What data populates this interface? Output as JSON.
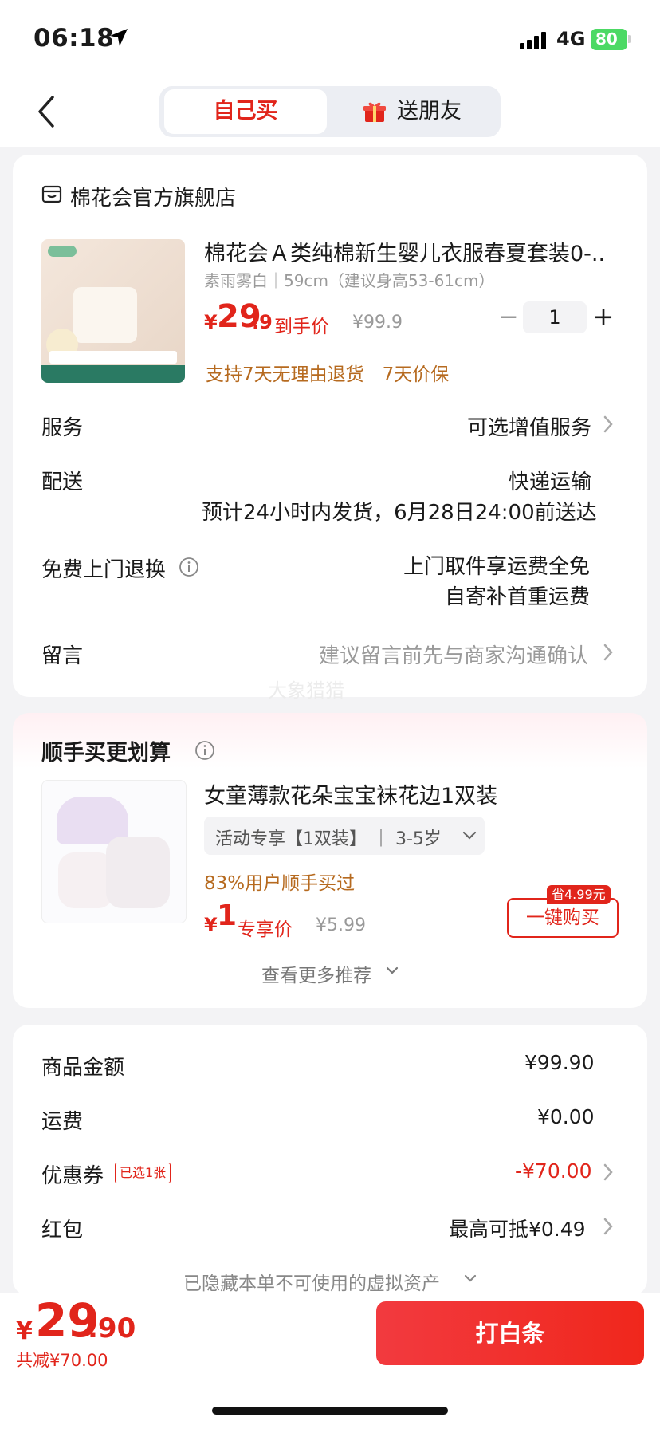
{
  "status": {
    "time": "06:18",
    "network": "4G",
    "battery": "80"
  },
  "header": {
    "tab_self": "自己买",
    "tab_friend": "送朋友"
  },
  "store": {
    "name": "棉花会官方旗舰店"
  },
  "product": {
    "title": "棉花会Ａ类纯棉新生婴儿衣服春夏套装0-...",
    "spec": "素雨雾白｜59cm（建议身高53-61cm）",
    "price_symbol": "¥",
    "price_int": "29",
    "price_dec": ".9",
    "price_tag": "到手价",
    "price_original": "¥99.9",
    "quantity": "1",
    "guarantee": "支持7天无理由退货　7天价保"
  },
  "rows": {
    "service_label": "服务",
    "service_value": "可选增值服务",
    "delivery_label": "配送",
    "delivery_value1": "快递运输",
    "delivery_value2": "预计24小时内发货，6月28日24:00前送达",
    "return_label": "免费上门退换",
    "return_value1": "上门取件享运费全免",
    "return_value2": "自寄补首重运费",
    "message_label": "留言",
    "message_value": "建议留言前先与商家沟通确认"
  },
  "watermark": "大象猎猎",
  "upsell": {
    "title": "顺手买更划算",
    "name": "女童薄款花朵宝宝袜花边1双装",
    "spec": "活动专享【1双装】 ｜ 3-5岁",
    "stat": "83%用户顺手买过",
    "price_symbol": "¥",
    "price": "1",
    "price_tag": "专享价",
    "price_original": "¥5.99",
    "save_badge": "省4.99元",
    "buy_button": "一键购买",
    "more": "查看更多推荐"
  },
  "summary": {
    "amount_label": "商品金额",
    "amount_value": "¥99.90",
    "shipping_label": "运费",
    "shipping_value": "¥0.00",
    "coupon_label": "优惠券",
    "coupon_tag": "已选1张",
    "coupon_value": "-¥70.00",
    "redpacket_label": "红包",
    "redpacket_value": "最高可抵¥0.49",
    "hidden_assets": "已隐藏本单不可使用的虚拟资产"
  },
  "footer": {
    "total_symbol": "¥",
    "total_int": "29",
    "total_dec": ".90",
    "total_saved": "共减¥70.00",
    "pay_button": "打白条"
  },
  "colors": {
    "accent": "#e1251b",
    "orange": "#b66a1f",
    "battery": "#4cd964"
  }
}
